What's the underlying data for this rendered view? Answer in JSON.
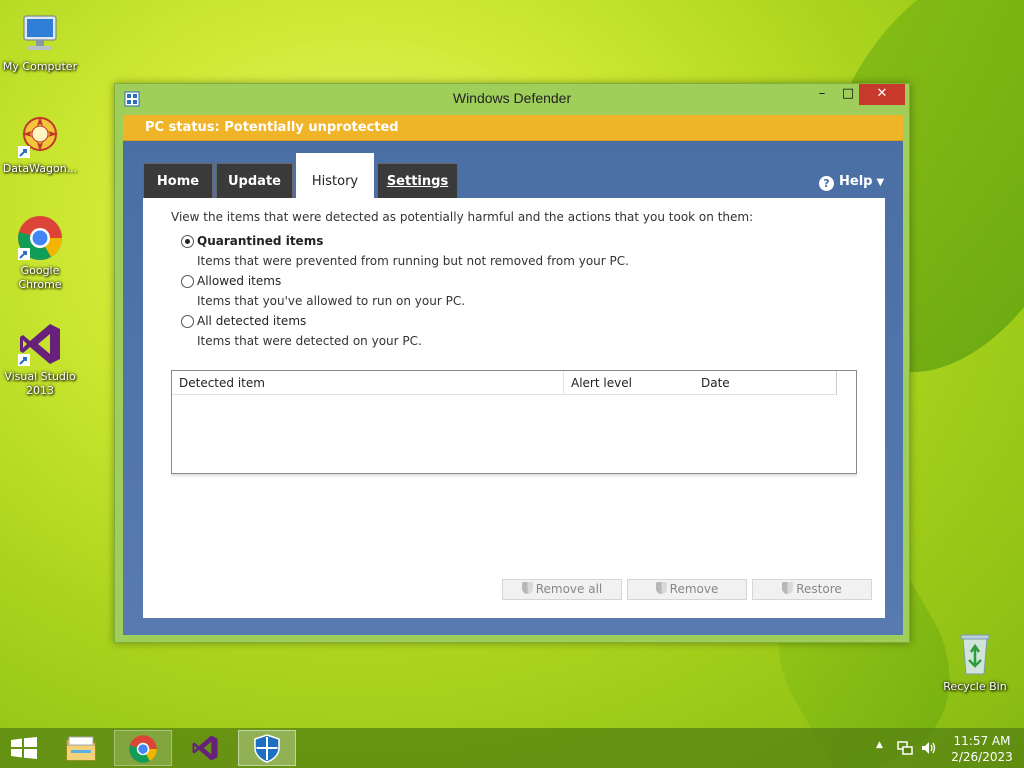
{
  "desktop": {
    "icons": [
      {
        "label": "My Computer",
        "icon": "computer-icon"
      },
      {
        "label": "DataWagon...",
        "icon": "datawagon-icon"
      },
      {
        "label": "Google Chrome",
        "icon": "chrome-icon"
      },
      {
        "label": "Visual Studio 2013",
        "icon": "visual-studio-icon"
      },
      {
        "label": "Recycle Bin",
        "icon": "recycle-bin-icon"
      }
    ]
  },
  "window": {
    "title": "Windows Defender",
    "controls": {
      "minimize": "–",
      "maximize": "□",
      "close": "✕"
    },
    "status": "PC status: Potentially unprotected",
    "tabs": [
      {
        "label": "Home",
        "active": false
      },
      {
        "label": "Update",
        "active": false
      },
      {
        "label": "History",
        "active": true
      },
      {
        "label": "Settings",
        "active": false
      }
    ],
    "help": {
      "label": "Help",
      "icon": "help-icon"
    },
    "content": {
      "intro": "View the items that were detected as potentially harmful and the actions that you took on them:",
      "options": [
        {
          "label": "Quarantined items",
          "desc": "Items that were prevented from running but not removed from your PC.",
          "checked": true
        },
        {
          "label": "Allowed items",
          "desc": "Items that you've allowed to run on your PC.",
          "checked": false
        },
        {
          "label": "All detected items",
          "desc": "Items that were detected on your PC.",
          "checked": false
        }
      ],
      "table": {
        "columns": [
          "Detected item",
          "Alert level",
          "Date"
        ],
        "rows": []
      },
      "buttons": {
        "remove_all": "Remove all",
        "remove": "Remove",
        "restore": "Restore"
      }
    }
  },
  "taskbar": {
    "items": [
      "start-icon",
      "file-explorer-icon",
      "chrome-icon",
      "visual-studio-icon",
      "windows-defender-icon"
    ],
    "clock": {
      "time": "11:57 AM",
      "date": "2/26/2023"
    }
  },
  "colors": {
    "status_bar": "#f0b429",
    "window_frame": "#9fcf5a",
    "blue_area": "#4a6fa5",
    "close_button": "#c7392b"
  }
}
